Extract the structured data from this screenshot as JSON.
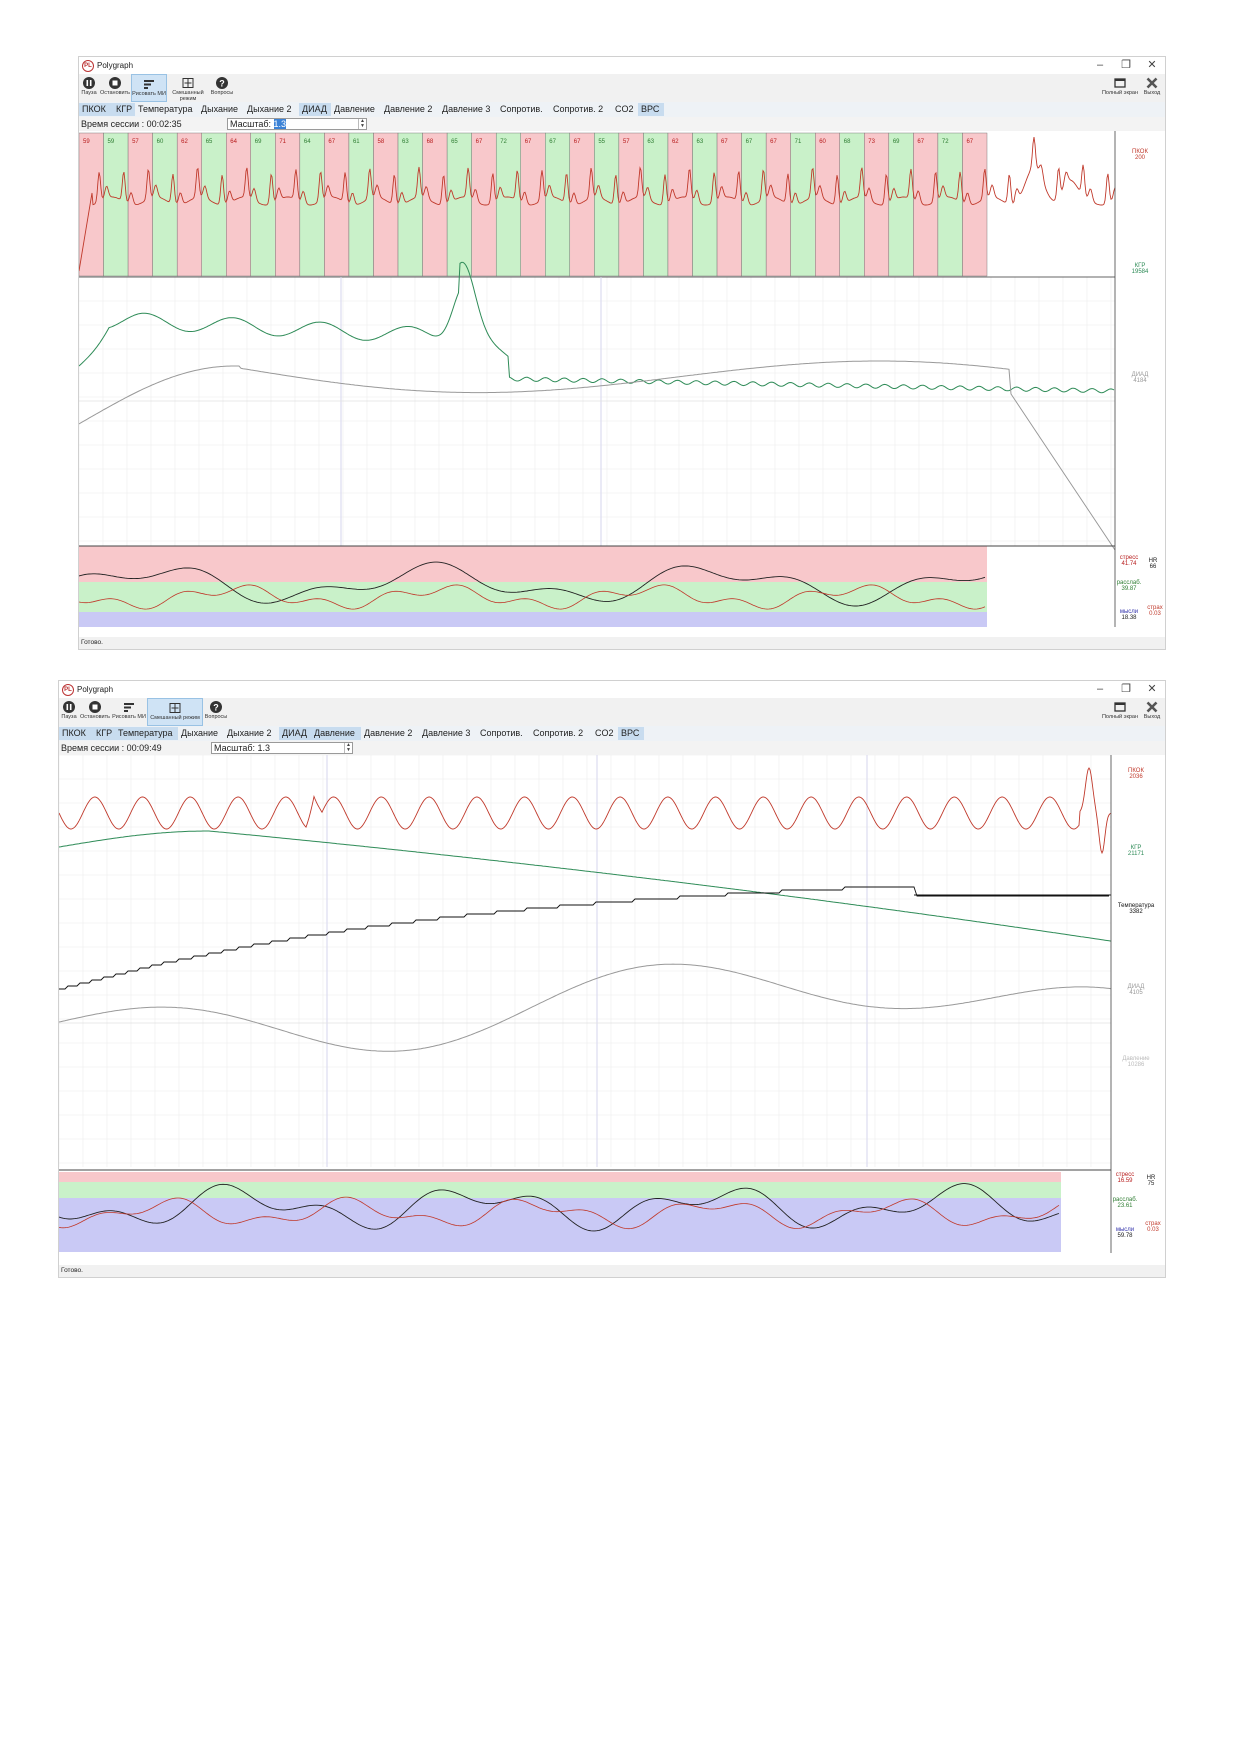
{
  "screens": [
    {
      "title": "Polygraph",
      "toolbar": [
        "Пауза",
        "Остановить",
        "Рисовать МИ",
        "Смешанный режим",
        "Вопросы"
      ],
      "active_tool": 2,
      "right_tools": [
        "Полный экран",
        "Выход"
      ],
      "tabs": [
        "ПКОК",
        "КГР",
        "Температура",
        "Дыхание",
        "Дыхание 2",
        "ДИАД",
        "Давление",
        "Давление 2",
        "Давление 3",
        "Сопротив.",
        "Сопротив. 2",
        "CO2",
        "ВРС"
      ],
      "active_tabs": [
        0,
        1,
        5,
        12
      ],
      "session_label": "Время сессии : 00:02:35",
      "scale_prefix": "Масштаб: ",
      "scale_value": "1.3",
      "scale_selected": true,
      "status": "Готово.",
      "beat_numbers": [
        "59",
        "59",
        "57",
        "60",
        "62",
        "65",
        "64",
        "69",
        "71",
        "64",
        "67",
        "61",
        "58",
        "63",
        "68",
        "65",
        "67",
        "72",
        "67",
        "67",
        "67",
        "55",
        "57",
        "63",
        "62",
        "63",
        "67",
        "67",
        "67",
        "71",
        "60",
        "68",
        "73",
        "69",
        "67",
        "72",
        "67"
      ],
      "channels": [
        {
          "name": "ПКОК",
          "value": "200",
          "color": "#c0392b"
        },
        {
          "name": "КГР",
          "value": "19584",
          "color": "#2e8b57"
        },
        {
          "name": "ДИАД",
          "value": "4184",
          "color": "#999999"
        }
      ],
      "indicators": {
        "stress_label": "стресс",
        "stress": "41.74",
        "hr_label": "HR",
        "hr": "66",
        "relax_label": "расслаб.",
        "relax": "39.87",
        "fear_label": "страх",
        "fear": "0.03",
        "thought_label": "мысли",
        "thought": "18.38"
      }
    },
    {
      "title": "Polygraph",
      "toolbar": [
        "Пауза",
        "Остановить",
        "Рисовать МИ",
        "Смешанный режим",
        "Вопросы"
      ],
      "active_tool": 3,
      "right_tools": [
        "Полный экран",
        "Выход"
      ],
      "tabs": [
        "ПКОК",
        "КГР",
        "Температура",
        "Дыхание",
        "Дыхание 2",
        "ДИАД",
        "Давление",
        "Давление 2",
        "Давление 3",
        "Сопротив.",
        "Сопротив. 2",
        "CO2",
        "ВРС"
      ],
      "active_tabs": [
        0,
        1,
        2,
        5,
        6,
        12
      ],
      "session_label": "Время сессии : 00:09:49",
      "scale_prefix": "Масштаб: ",
      "scale_value": "1.3",
      "scale_selected": false,
      "status": "Готово.",
      "channels": [
        {
          "name": "ПКОК",
          "value": "2036",
          "color": "#c0392b"
        },
        {
          "name": "КГР",
          "value": "21171",
          "color": "#2e8b57"
        },
        {
          "name": "Температура",
          "value": "3382",
          "color": "#111111"
        },
        {
          "name": "ДИАД",
          "value": "4105",
          "color": "#999999"
        },
        {
          "name": "Давление",
          "value": "10286",
          "color": "#bbbbbb"
        }
      ],
      "indicators": {
        "stress_label": "стресс",
        "stress": "16.59",
        "hr_label": "HR",
        "hr": "75",
        "relax_label": "расслаб.",
        "relax": "23.61",
        "fear_label": "страх",
        "fear": "0.03",
        "thought_label": "мысли",
        "thought": "59.78"
      }
    }
  ],
  "colors": {
    "pulse": "#c0392b",
    "gsr": "#2e8b57",
    "diad": "#999999",
    "pressure": "#bbbbbb",
    "temp": "#111111",
    "red_band": "#f8c8cb",
    "green_band": "#c9f1c9",
    "blue_band": "#c9c9f5",
    "accent": "#3b82d6"
  }
}
